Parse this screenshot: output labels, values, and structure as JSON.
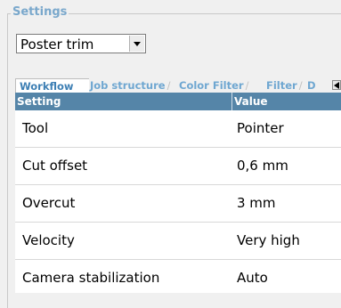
{
  "group_title": "Settings",
  "mode_select": {
    "value": "Poster trim"
  },
  "tabs": [
    {
      "label": "Workflow",
      "active": true
    },
    {
      "label": "Job structure",
      "active": false
    },
    {
      "label": "Color Filter",
      "active": false
    },
    {
      "label": "Filter",
      "active": false
    },
    {
      "label": "D",
      "active": false
    }
  ],
  "table": {
    "headers": [
      "Setting",
      "Value"
    ],
    "rows": [
      {
        "setting": "Tool",
        "value": "Pointer"
      },
      {
        "setting": "Cut offset",
        "value": "0,6 mm"
      },
      {
        "setting": "Overcut",
        "value": "3 mm"
      },
      {
        "setting": "Velocity",
        "value": "Very high"
      },
      {
        "setting": "Camera stabilization",
        "value": "Auto"
      }
    ]
  },
  "colors": {
    "header_bg": "#5585a8",
    "title_text": "#7aa8cc",
    "tab_text": "#6fa7d1"
  }
}
